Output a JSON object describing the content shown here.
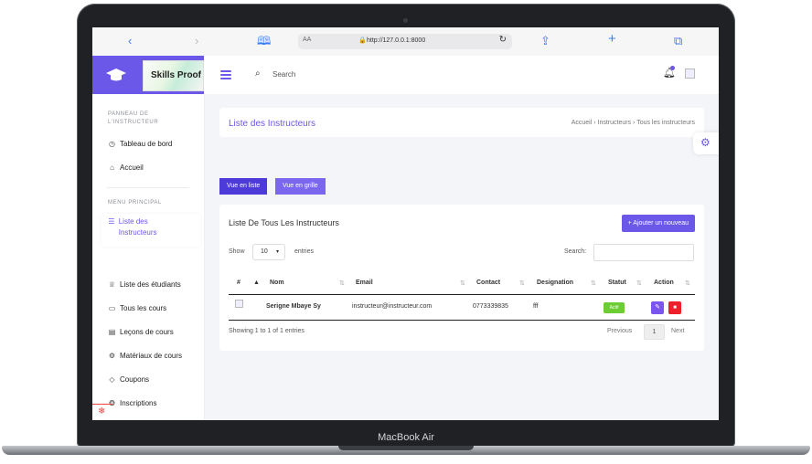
{
  "device": {
    "label": "MacBook Air"
  },
  "browser": {
    "back_icon": "chevron-left-icon",
    "forward_icon": "chevron-right-icon",
    "reader_icon": "book-icon",
    "text_size": "AA",
    "url": "http://127.0.0.1:8000",
    "reload_icon": "reload-icon",
    "share_icon": "share-icon",
    "new_tab_icon": "plus-icon",
    "tabs_icon": "tabs-icon"
  },
  "brand": {
    "name": "Skills Proof",
    "accent": "#6b57e8"
  },
  "sidebar": {
    "section1": "PANNEAU DE L'INSTRUCTEUR",
    "items1": [
      {
        "label": "Tableau de bord",
        "icon": "clock-icon"
      },
      {
        "label": "Accueil",
        "icon": "home-icon"
      }
    ],
    "section2": "MENU PRINCIPAL",
    "items2": [
      {
        "label": "Liste des Instructeurs",
        "icon": "list-icon"
      },
      {
        "label": "Liste des étudiants",
        "icon": "graduate-icon"
      },
      {
        "label": "Tous les cours",
        "icon": "book-icon"
      },
      {
        "label": "Leçons de cours",
        "icon": "lesson-icon"
      },
      {
        "label": "Matériaux de cours",
        "icon": "materials-icon"
      },
      {
        "label": "Coupons",
        "icon": "tag-icon"
      },
      {
        "label": "Inscriptions",
        "icon": "enroll-icon"
      }
    ]
  },
  "topbar": {
    "search_label": "Search"
  },
  "page": {
    "title": "Liste des Instructeurs",
    "breadcrumb": [
      "Accueil",
      "Instructeurs",
      "Tous les instructeurs"
    ],
    "view_list": "Vue en liste",
    "view_grid": "Vue en grille"
  },
  "table_card": {
    "title": "Liste De Tous Les Instructeurs",
    "add_button": "+ Ajouter un nouveau",
    "show_label": "Show",
    "show_value": "10",
    "entries_label": "entries",
    "search_label": "Search:",
    "columns": [
      "#",
      "Nom",
      "Email",
      "Contact",
      "Designation",
      "Statut",
      "Action"
    ],
    "rows": [
      {
        "nom": "Serigne Mbaye Sy",
        "email": "instructeur@instructeur.com",
        "contact": "0773339835",
        "designation": "fff",
        "statut": "Actif"
      }
    ],
    "info": "Showing 1 to 1 of 1 entries",
    "pagination": {
      "prev": "Previous",
      "current": "1",
      "next": "Next"
    }
  }
}
